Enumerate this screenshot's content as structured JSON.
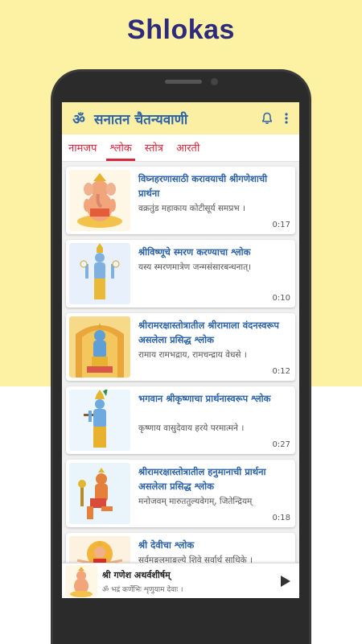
{
  "promo": {
    "title": "Shlokas"
  },
  "app": {
    "title": "सनातन चैतन्यवाणी"
  },
  "icons": {
    "logo": "om-icon",
    "notifications": "bell-icon",
    "menu": "more-vert-icon",
    "player": "play-icon"
  },
  "tabs": [
    {
      "label": "नामजप",
      "active": false
    },
    {
      "label": "श्लोक",
      "active": true
    },
    {
      "label": "स्तोत्र",
      "active": false
    },
    {
      "label": "आरती",
      "active": false
    }
  ],
  "items": [
    {
      "title": "विघ्नहरणासाठी करावयाची श्रीगणेशाची प्रार्थना",
      "subtitle": "वक्रतुंड महाकाय कोटीसूर्य समप्रभ ।",
      "duration": "0:17",
      "image": "ganesha"
    },
    {
      "title": "श्रीविष्णूचे स्मरण करण्याचा श्लोक",
      "subtitle": "यस्य स्मरणमात्रेण जन्मसंसारबन्धनात्।",
      "duration": "0:10",
      "image": "vishnu"
    },
    {
      "title": "श्रीरामरक्षास्तोत्रातील श्रीरामाला वंदनस्वरूप असलेला प्रसिद्ध श्लोक",
      "subtitle": "रामाय रामभद्राय, रामचन्द्राय वेधसे ।",
      "duration": "0:12",
      "image": "rama"
    },
    {
      "title": "भगवान श्रीकृष्णाचा प्रार्थनास्वरूप श्लोक",
      "subtitle": "कृष्णाय वासुदेवाय हरये परमात्मने ।",
      "duration": "0:27",
      "image": "krishna"
    },
    {
      "title": "श्रीरामरक्षास्तोत्रातील हनुमानाची प्रार्थना असलेला प्रसिद्ध श्लोक",
      "subtitle": "मनोजवम् मारुततुल्यवेगम्, जितेन्द्रियम्",
      "duration": "0:18",
      "image": "hanuman"
    },
    {
      "title": "श्री देवीचा श्लोक",
      "subtitle": "सर्वमङ्गलमाङ्गल्ये शिवे सर्वार्थ साधिके ।",
      "duration": "",
      "image": "devi"
    }
  ],
  "player": {
    "title": "श्री गणेश अथर्वशीर्षम्",
    "subtitle": "ॐ भद्रं कर्णेभिः शृणुयाम देवाः ।"
  },
  "colors": {
    "accent": "#2b62a8",
    "tab": "#d8283e",
    "appbar": "#fbefa4",
    "promo_bg": "#fdf2a3",
    "promo_title": "#2e2a7e"
  }
}
